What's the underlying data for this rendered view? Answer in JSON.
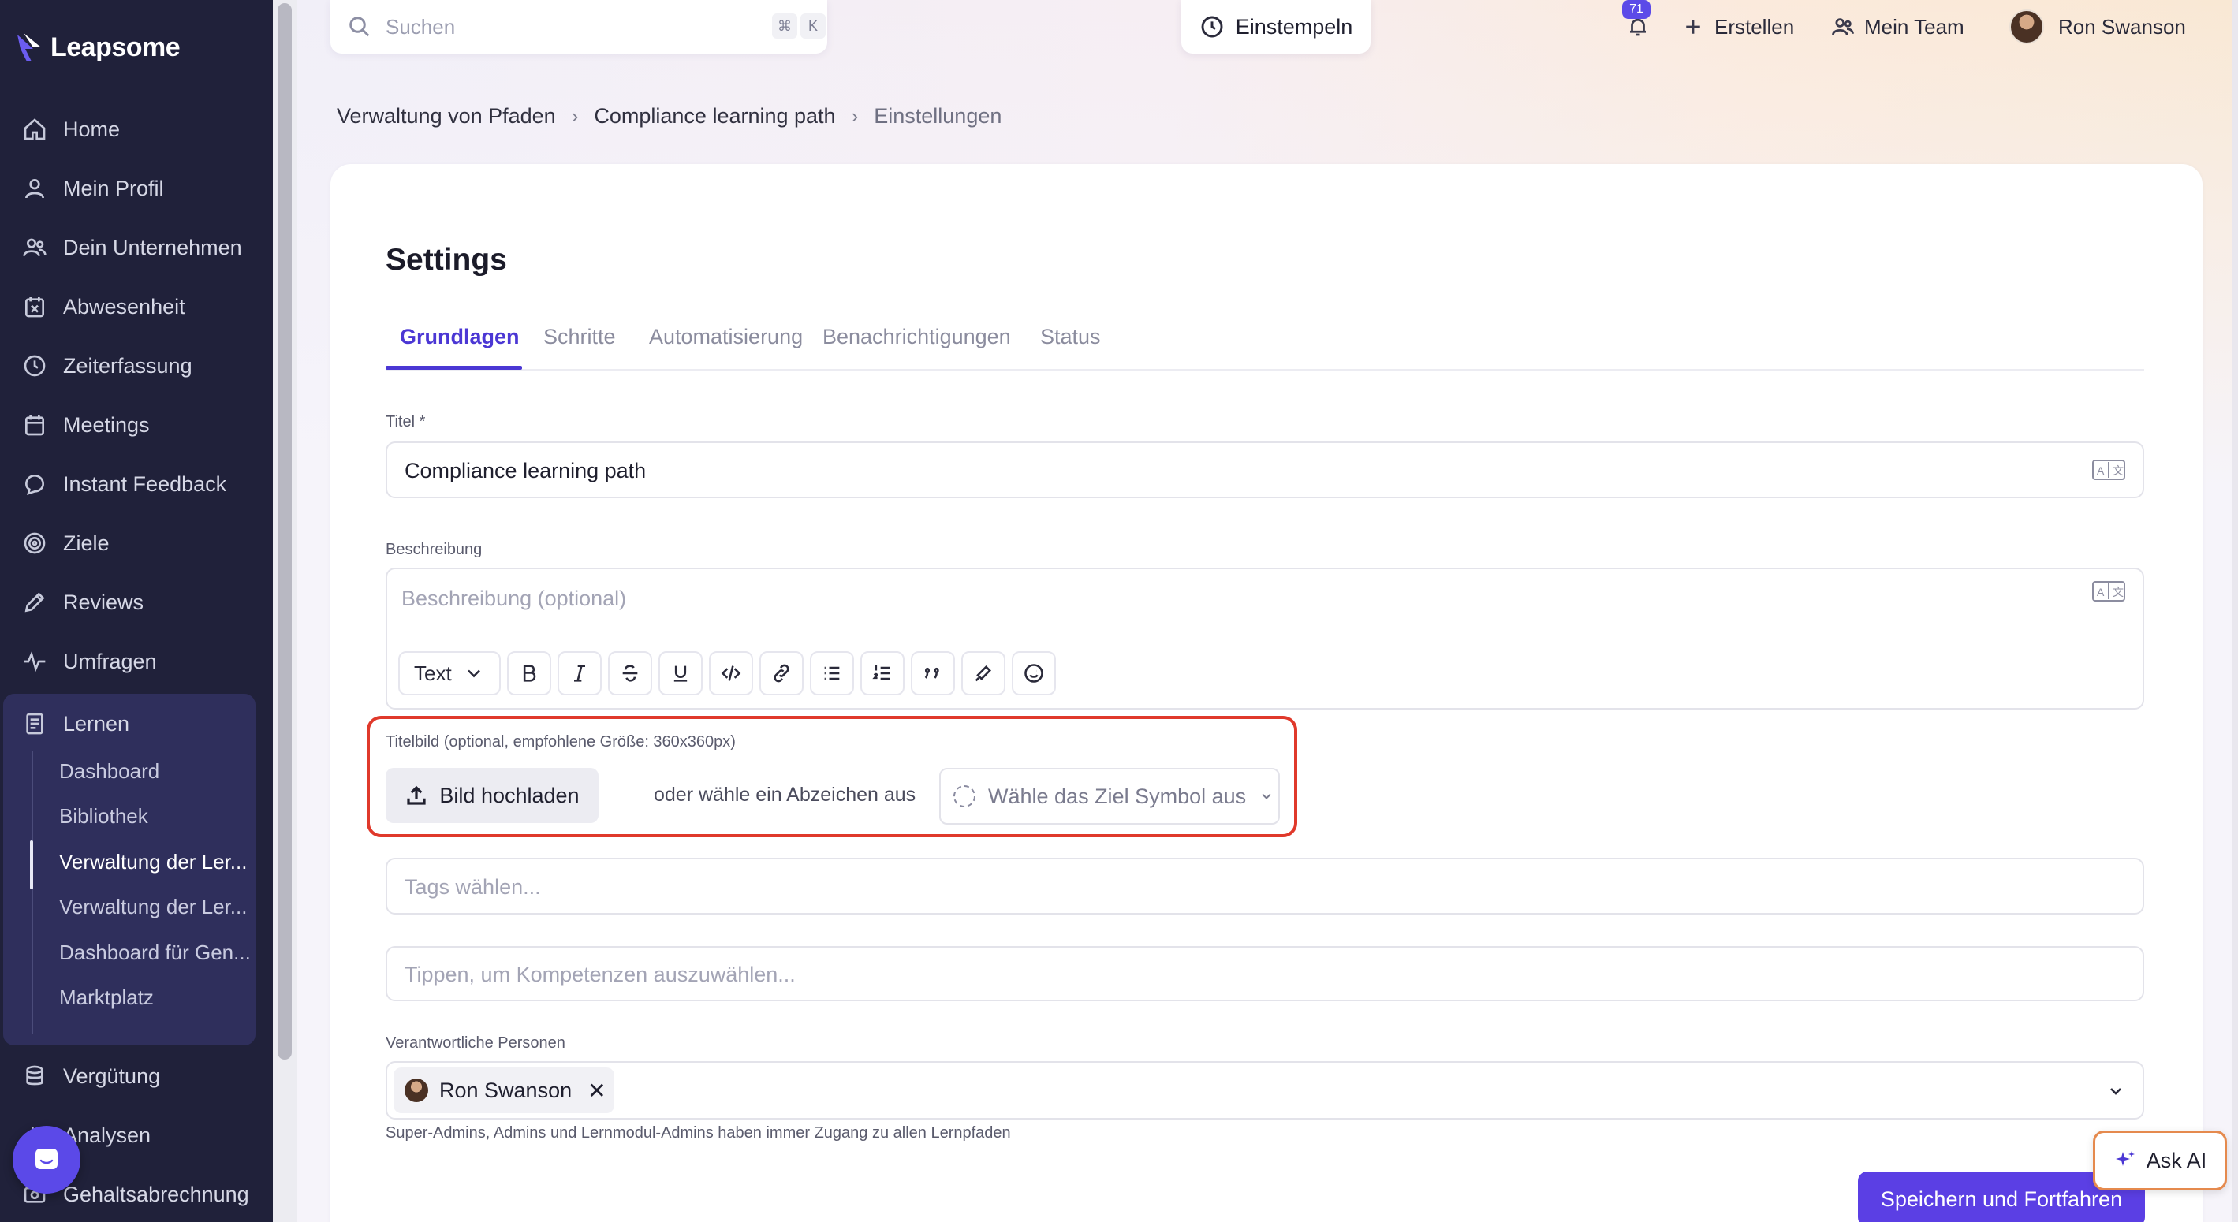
{
  "app": {
    "name": "Leapsome"
  },
  "sidebar": {
    "items": [
      {
        "label": "Home",
        "icon": "home-icon"
      },
      {
        "label": "Mein Profil",
        "icon": "user-icon"
      },
      {
        "label": "Dein Unternehmen",
        "icon": "users-icon"
      },
      {
        "label": "Abwesenheit",
        "icon": "calendar-x-icon"
      },
      {
        "label": "Zeiterfassung",
        "icon": "clock-icon"
      },
      {
        "label": "Meetings",
        "icon": "calendar-icon"
      },
      {
        "label": "Instant Feedback",
        "icon": "chat-icon"
      },
      {
        "label": "Ziele",
        "icon": "target-icon"
      },
      {
        "label": "Reviews",
        "icon": "pen-icon"
      },
      {
        "label": "Umfragen",
        "icon": "pulse-icon"
      },
      {
        "label": "Lernen",
        "icon": "book-icon"
      },
      {
        "label": "Vergütung",
        "icon": "coins-icon"
      },
      {
        "label": "Analysen",
        "icon": "chart-icon"
      },
      {
        "label": "Gehaltsabrechnung",
        "icon": "payroll-icon"
      }
    ],
    "learn_sub": [
      {
        "label": "Dashboard"
      },
      {
        "label": "Bibliothek"
      },
      {
        "label": "Verwaltung der Ler..."
      },
      {
        "label": "Verwaltung der Ler..."
      },
      {
        "label": "Dashboard für Gen..."
      },
      {
        "label": "Marktplatz"
      }
    ]
  },
  "topbar": {
    "search_placeholder": "Suchen",
    "kbd_cmd": "⌘",
    "kbd_k": "K",
    "clock_in": "Einstempeln",
    "notifications_count": "71",
    "create": "Erstellen",
    "my_team": "Mein Team",
    "user_name": "Ron Swanson"
  },
  "breadcrumb": {
    "items": [
      "Verwaltung von Pfaden",
      "Compliance learning path",
      "Einstellungen"
    ]
  },
  "page": {
    "title": "Settings",
    "tabs": [
      "Grundlagen",
      "Schritte",
      "Automatisierung",
      "Benachrichtigungen",
      "Status"
    ],
    "active_tab": "Grundlagen"
  },
  "form": {
    "title_label": "Titel *",
    "title_value": "Compliance learning path",
    "description_label": "Beschreibung",
    "description_placeholder": "Beschreibung (optional)",
    "toolbar_text_style": "Text",
    "cover_label": "Titelbild (optional, empfohlene Größe: 360x360px)",
    "upload_button": "Bild hochladen",
    "or_choose_badge": "oder wähle ein Abzeichen aus",
    "badge_select_placeholder": "Wähle das Ziel Symbol aus",
    "tags_placeholder": "Tags wählen...",
    "skills_placeholder": "Tippen, um Kompetenzen auszuwählen...",
    "owners_label": "Verantwortliche Personen",
    "owner_chip": "Ron Swanson",
    "owners_helper": "Super-Admins, Admins und Lernmodul-Admins haben immer Zugang zu allen Lernpfaden",
    "save_button": "Speichern und Fortfahren"
  },
  "ask_ai": "Ask AI",
  "colors": {
    "sidebar_bg": "#20213a",
    "accent": "#4b37d4",
    "primary_button": "#5b3fe4",
    "highlight_border": "#e0392b"
  }
}
